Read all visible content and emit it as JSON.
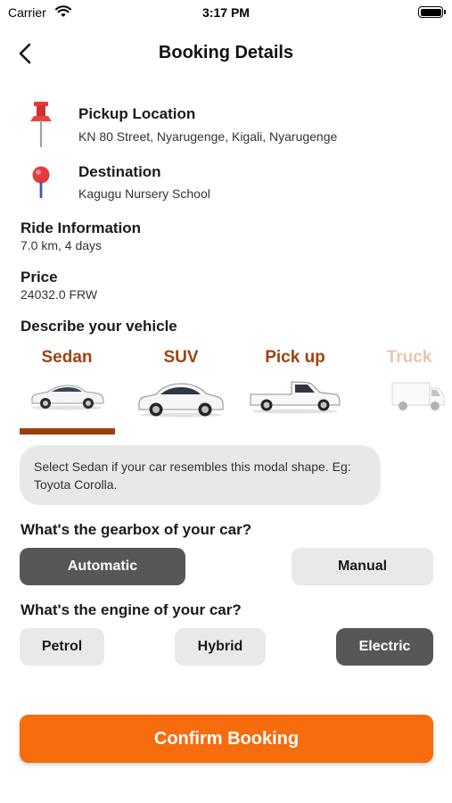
{
  "status_bar": {
    "carrier": "Carrier",
    "time": "3:17 PM"
  },
  "header": {
    "title": "Booking Details",
    "back_icon": "chevron-left-icon"
  },
  "pickup": {
    "title": "Pickup Location",
    "address": "KN 80 Street, Nyarugenge, Kigali, Nyarugenge",
    "icon": "push-pin-icon"
  },
  "destination": {
    "title": "Destination",
    "address": "Kagugu Nursery School",
    "icon": "map-pin-icon"
  },
  "ride_info": {
    "title": "Ride Information",
    "value": "7.0 km, 4 days"
  },
  "price": {
    "title": "Price",
    "value": "24032.0 FRW"
  },
  "vehicle": {
    "title": "Describe your vehicle",
    "selected": "Sedan",
    "types": [
      {
        "label": "Sedan",
        "icon": "sedan-car-icon"
      },
      {
        "label": "SUV",
        "icon": "suv-car-icon"
      },
      {
        "label": "Pick up",
        "icon": "pickup-truck-icon"
      },
      {
        "label": "Truck",
        "icon": "box-truck-icon"
      }
    ],
    "hint": "Select Sedan if your car resembles this modal shape. Eg: Toyota Corolla."
  },
  "gearbox": {
    "title": "What's the gearbox of your car?",
    "options": [
      "Automatic",
      "Manual"
    ],
    "selected": "Automatic"
  },
  "engine": {
    "title": "What's the engine of your car?",
    "options": [
      "Petrol",
      "Hybrid",
      "Electric"
    ],
    "selected": "Electric"
  },
  "confirm_label": "Confirm Booking",
  "colors": {
    "accent": "#f76c0d",
    "vehicle_label": "#a04210",
    "tab_indicator": "#9b3f0f",
    "selected_button": "#575757",
    "unselected_button": "#e9e9e9"
  }
}
